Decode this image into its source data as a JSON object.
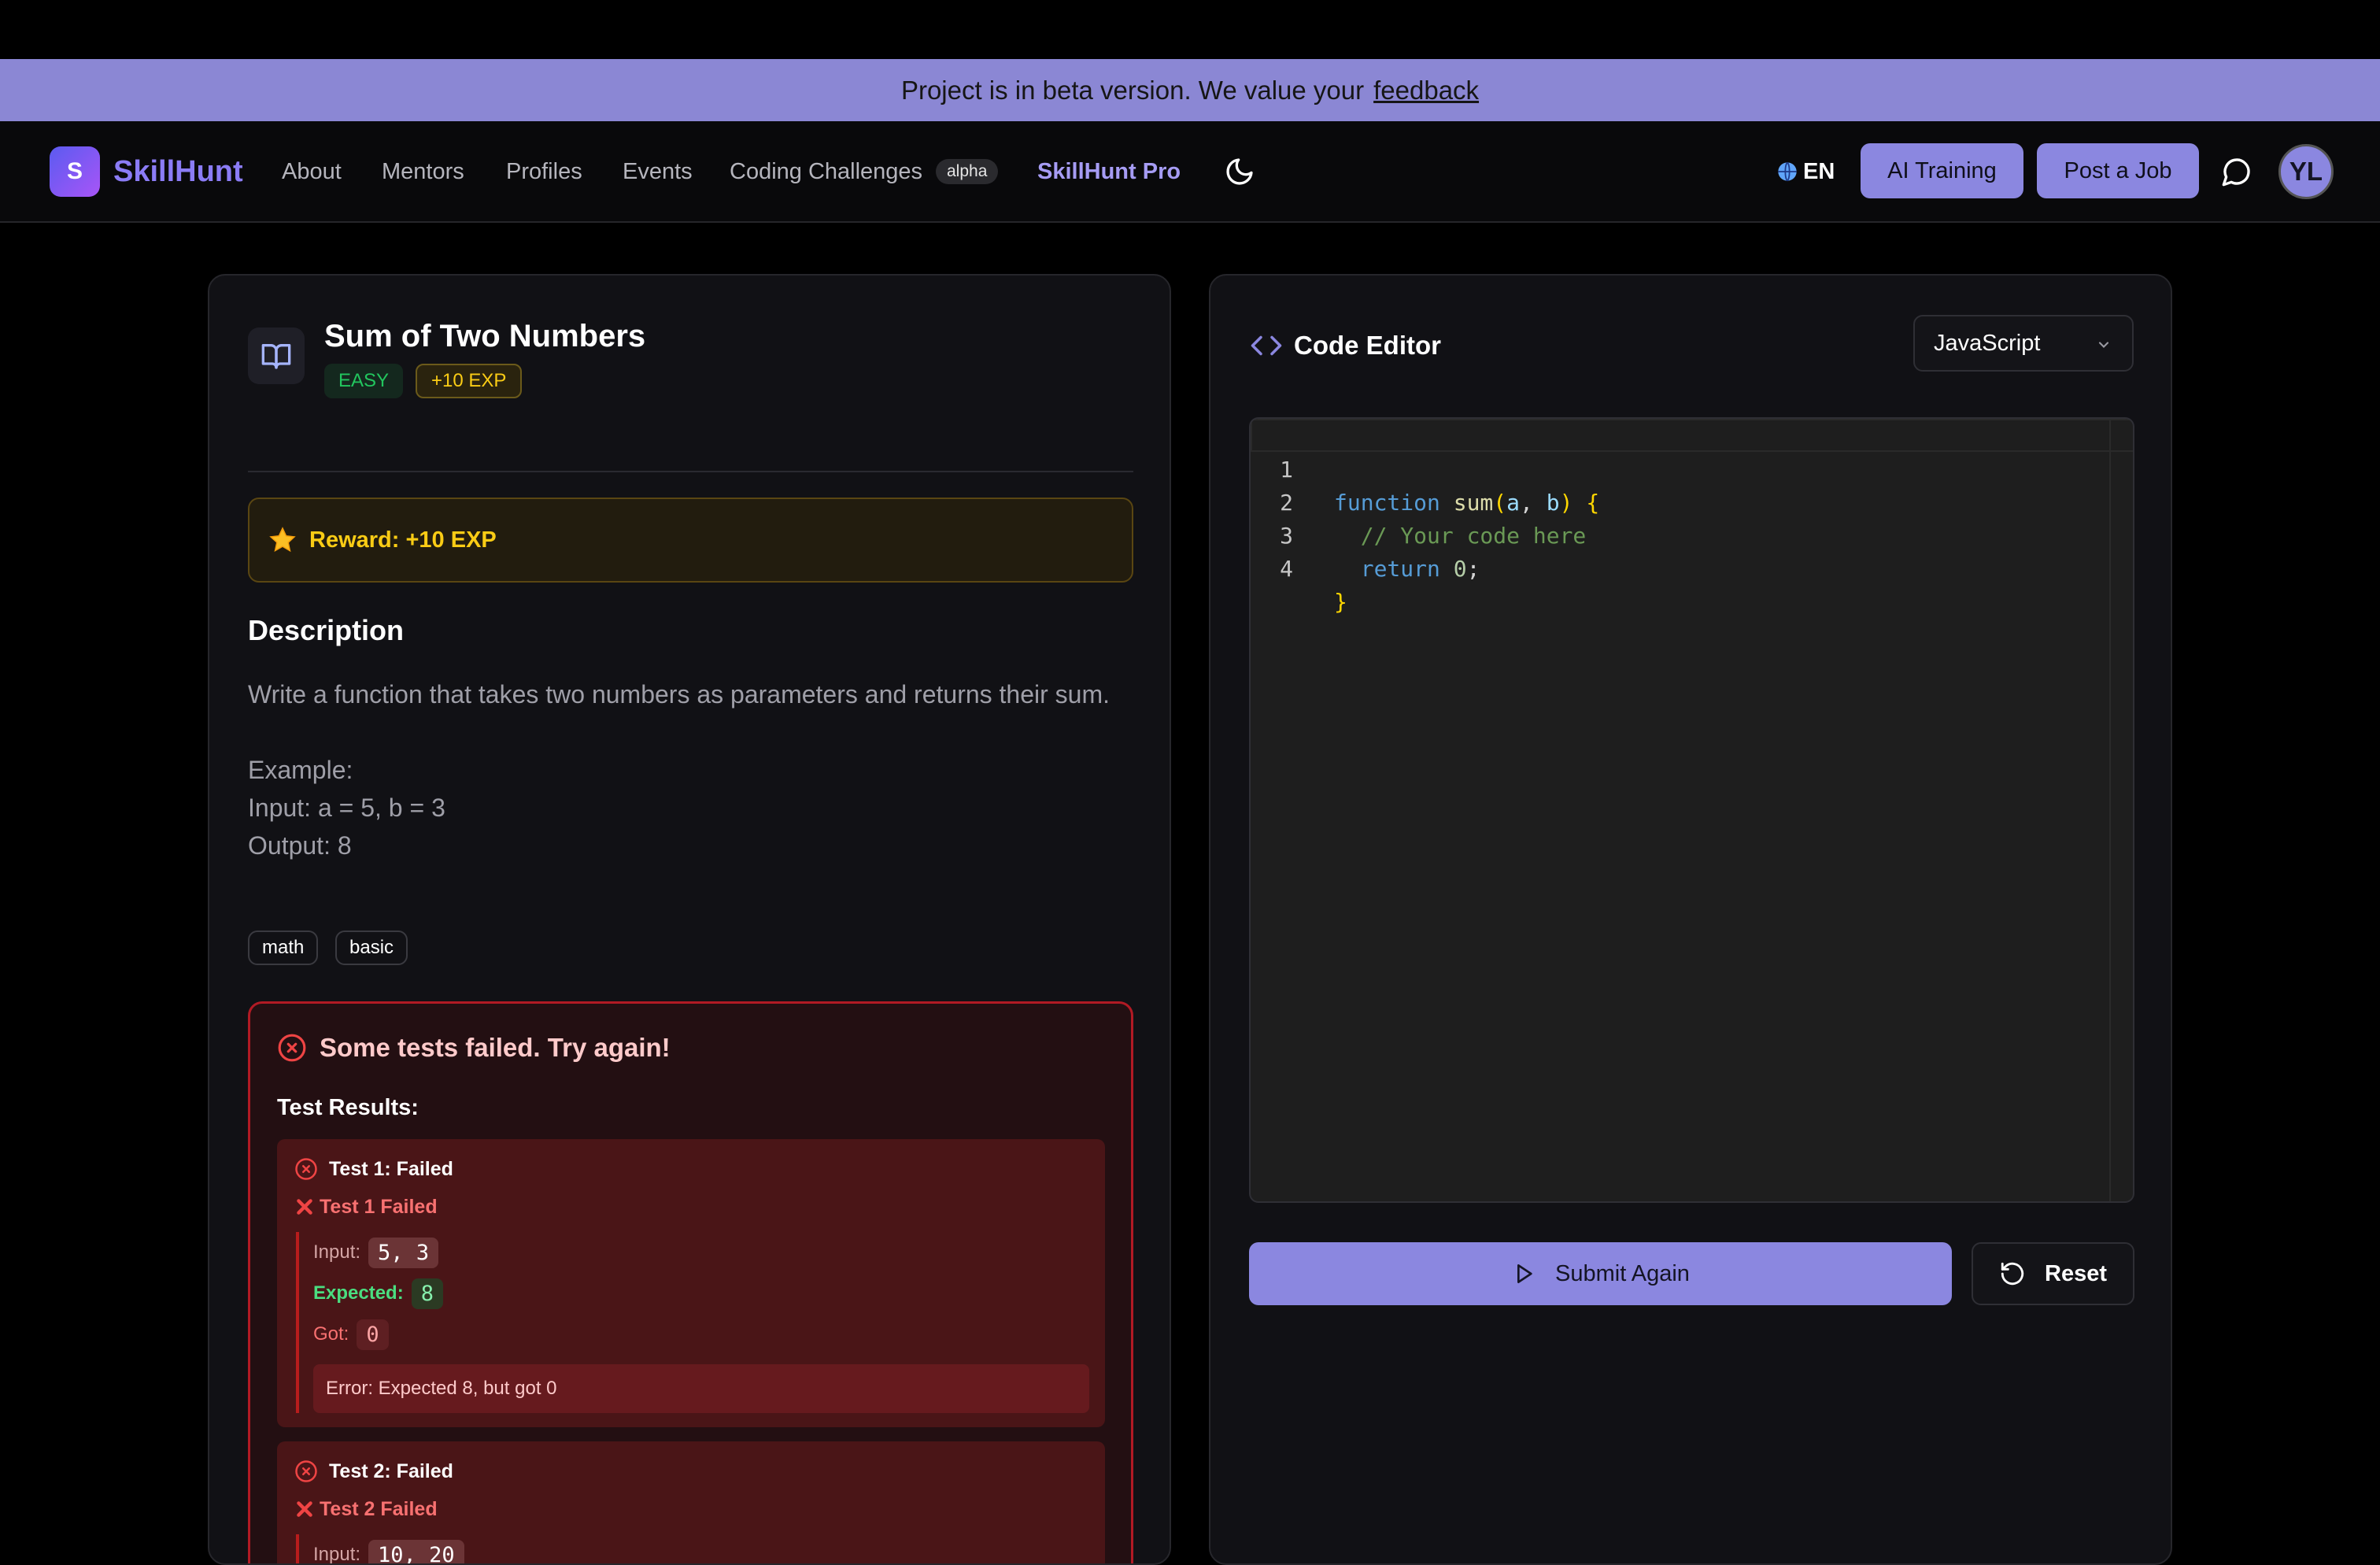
{
  "banner": {
    "text": "Project is in beta version. We value your",
    "link": "feedback"
  },
  "nav": {
    "logo_letter": "S",
    "brand": "SkillHunt",
    "links": [
      "About",
      "Mentors",
      "Profiles",
      "Events",
      "Coding Challenges"
    ],
    "alpha_badge": "alpha",
    "pro": "SkillHunt Pro",
    "lang": "EN",
    "ai_training": "AI Training",
    "post_job": "Post a Job",
    "avatar": "YL"
  },
  "challenge": {
    "title": "Sum of Two Numbers",
    "difficulty": "EASY",
    "exp_badge": "+10 EXP",
    "reward": "Reward: +10 EXP",
    "description_heading": "Description",
    "description": "Write a function that takes two numbers as parameters and returns their sum.",
    "example_label": "Example:",
    "example_input": "Input: a = 5, b = 3",
    "example_output": "Output: 8",
    "tags": [
      "math",
      "basic"
    ]
  },
  "results": {
    "status": "Some tests failed. Try again!",
    "label": "Test Results:",
    "tests": [
      {
        "head": "Test 1: Failed",
        "sub": "Test 1 Failed",
        "input_label": "Input:",
        "input": "5, 3",
        "expected_label": "Expected:",
        "expected": "8",
        "got_label": "Got:",
        "got": "0",
        "error": "Error: Expected 8, but got 0"
      },
      {
        "head": "Test 2: Failed",
        "sub": "Test 2 Failed",
        "input_label": "Input:",
        "input": "10, 20"
      }
    ]
  },
  "editor": {
    "title": "Code Editor",
    "language": "JavaScript",
    "line_numbers": [
      "1",
      "2",
      "3",
      "4"
    ],
    "submit": "Submit Again",
    "reset": "Reset"
  },
  "colors": {
    "accent": "#8b87e0",
    "brand": "#8b7cf6",
    "error": "#b11a24",
    "success": "#22c55e",
    "gold": "#facc15"
  }
}
